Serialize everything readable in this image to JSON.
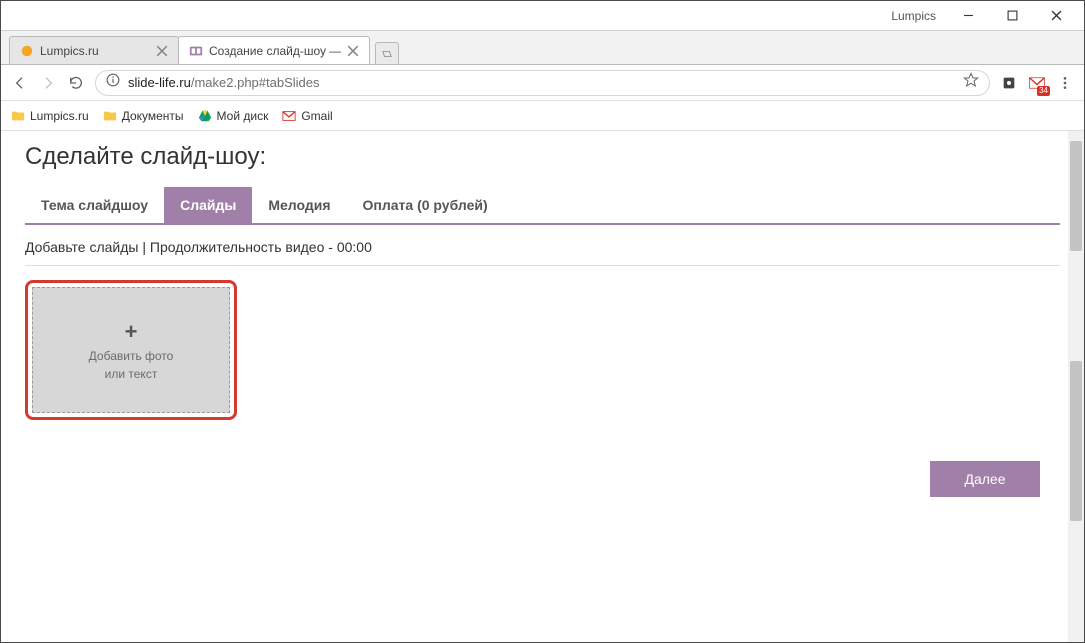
{
  "window": {
    "title": "Lumpics"
  },
  "browser_tabs": [
    {
      "title": "Lumpics.ru",
      "active": false
    },
    {
      "title": "Создание слайд-шоу —",
      "active": true
    }
  ],
  "nav": {
    "url_host": "slide-life.ru",
    "url_path": "/make2.php#tabSlides",
    "gmail_badge": "34"
  },
  "bookmarks": {
    "b1": "Lumpics.ru",
    "b2": "Документы",
    "b3": "Мой диск",
    "b4": "Gmail"
  },
  "page": {
    "heading": "Сделайте слайд-шоу:",
    "tabs": {
      "theme": "Тема слайдшоу",
      "slides": "Слайды",
      "melody": "Мелодия",
      "payment": "Оплата (0 рублей)"
    },
    "subhead": "Добавьте слайды | Продолжительность видео - 00:00",
    "add_slide_line1": "Добавить фото",
    "add_slide_line2": "или текст",
    "next_button": "Далее"
  }
}
